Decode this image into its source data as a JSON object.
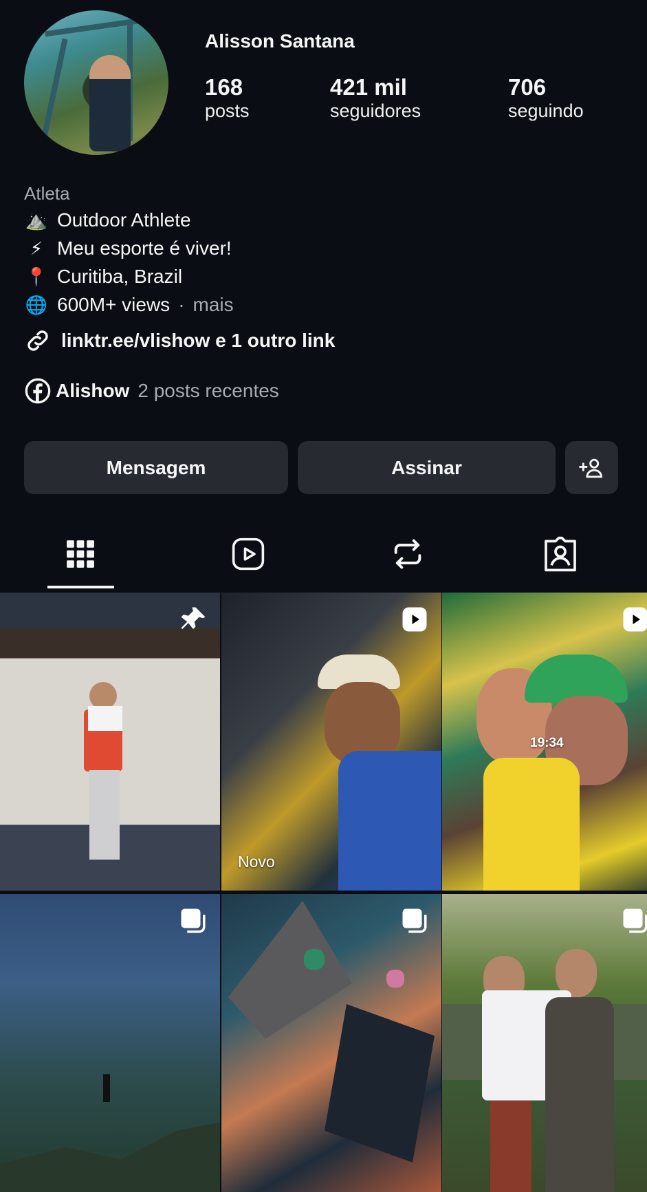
{
  "profile": {
    "name": "Alisson Santana",
    "stats": [
      {
        "value": "168",
        "label": "posts"
      },
      {
        "value": "421 mil",
        "label": "seguidores"
      },
      {
        "value": "706",
        "label": "seguindo"
      }
    ],
    "category": "Atleta",
    "bio": [
      {
        "icon": "mountain-icon",
        "glyph": "⛰️",
        "text": "Outdoor Athlete"
      },
      {
        "icon": "lightning-icon",
        "glyph": "⚡",
        "text": "Meu esporte é viver!"
      },
      {
        "icon": "pin-icon",
        "glyph": "📍",
        "text": "Curitiba, Brazil"
      },
      {
        "icon": "globe-icon",
        "glyph": "🌐",
        "text": "600M+ views"
      }
    ],
    "more_label": "mais",
    "link_text": "linktr.ee/vlishow e 1 outro link",
    "facebook": {
      "name": "Alishow",
      "recent": "2 posts recentes"
    }
  },
  "actions": {
    "message": "Mensagem",
    "subscribe": "Assinar"
  },
  "tabs": [
    "grid",
    "reels",
    "reposts",
    "tagged"
  ],
  "grid": [
    {
      "badge": "pin-icon",
      "caption": ""
    },
    {
      "badge": "reel-icon",
      "caption": "Novo"
    },
    {
      "badge": "reel-icon",
      "caption": "19:34"
    },
    {
      "badge": "carousel-icon",
      "caption": ""
    },
    {
      "badge": "carousel-icon",
      "caption": ""
    },
    {
      "badge": "carousel-icon",
      "caption": ""
    }
  ],
  "colors": {
    "background": "#0a0e14",
    "button": "#272a31",
    "muted_text": "#a7acb3"
  }
}
